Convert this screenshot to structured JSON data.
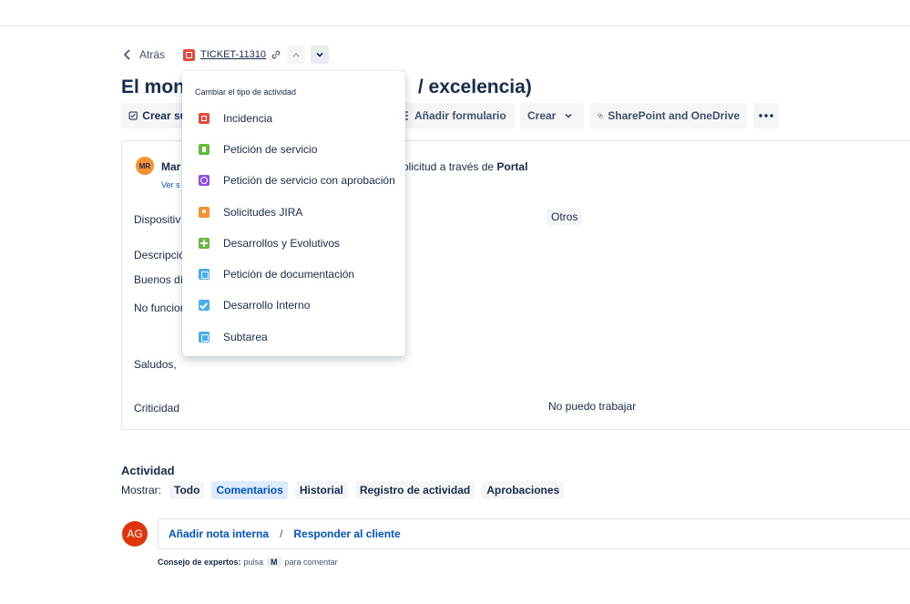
{
  "breadcrumb": {
    "back_label": "Atrás",
    "ticket_key": "TICKET-11310"
  },
  "issue": {
    "title_left": "El moni",
    "title_right": "/ excelencia)"
  },
  "toolbar": {
    "create_sub_label": "Crear su",
    "add_form_label": "Añadir formulario",
    "create_label": "Crear",
    "sharepoint_label": "SharePoint and OneDrive"
  },
  "card": {
    "reporter_avatar": "MR",
    "reporter_name": "Mar",
    "view_link": "Ver s",
    "request_via_prefix": "olicitud a través de",
    "request_via_channel": "Portal",
    "device_label": "Dispositiv",
    "device_value": "Otros",
    "description_label": "Descripció",
    "desc_line1": "Buenos día",
    "desc_line2": "No funcion",
    "desc_line3": "Saludos,",
    "criticidad_label": "Criticidad",
    "criticidad_value": "No puedo trabajar"
  },
  "activity": {
    "title": "Actividad",
    "show_label": "Mostrar:",
    "filters": [
      "Todo",
      "Comentarios",
      "Historial",
      "Registro de actividad",
      "Aprobaciones"
    ],
    "user_avatar": "AG",
    "internal_note": "Añadir nota interna",
    "separator": "/",
    "reply_customer": "Responder al cliente",
    "tip_bold": "Consejo de expertos:",
    "tip_press": "pulsa",
    "tip_key": "M",
    "tip_after": "para comentar"
  },
  "dropdown": {
    "header": "Cambiar el tipo de actividad",
    "items": [
      {
        "label": "Incidencia",
        "icon": "incidencia-icon"
      },
      {
        "label": "Petición de servicio",
        "icon": "peticion-servicio-icon"
      },
      {
        "label": "Petición de servicio con aprobación",
        "icon": "peticion-aprobacion-icon"
      },
      {
        "label": "Solicitudes JIRA",
        "icon": "solicitudes-jira-icon"
      },
      {
        "label": "Desarrollos y Evolutivos",
        "icon": "desarrollos-icon"
      },
      {
        "label": "Petición de documentación",
        "icon": "documentacion-icon"
      },
      {
        "label": "Desarrollo Interno",
        "icon": "desarrollo-interno-icon"
      },
      {
        "label": "Subtarea",
        "icon": "subtarea-icon"
      }
    ]
  },
  "colors": {
    "accent": "#0052cc",
    "incidencia": "#e5493a",
    "peticion": "#63ba3c",
    "aprobacion": "#904ee2",
    "jira": "#f79232",
    "info": "#4bade8"
  }
}
